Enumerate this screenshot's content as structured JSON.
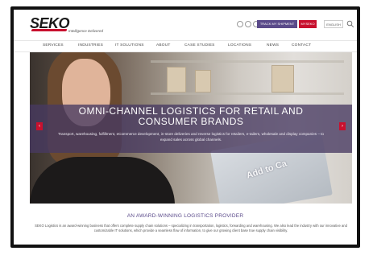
{
  "header": {
    "logo_text": "SEKO",
    "tagline": "Intelligence Delivered",
    "track_button": "TRACK MY SHIPMENT",
    "myseko_button": "MYSEKO",
    "language": "ENGLISH"
  },
  "nav": {
    "items": [
      "SERVICES",
      "INDUSTRIES",
      "IT SOLUTIONS",
      "ABOUT",
      "CASE STUDIES",
      "LOCATIONS",
      "NEWS",
      "CONTACT"
    ]
  },
  "hero": {
    "title": "OMNI-CHANNEL LOGISTICS FOR RETAIL AND CONSUMER BRANDS",
    "subtitle": "Transport, warehousing, fulfillment, eCommerce development, in-store deliveries and reverse logistics for retailers, e-tailers, wholesale and display companies – to expand sales across global channels.",
    "laptop_text": "Add to Ca",
    "prev_arrow": "‹",
    "next_arrow": "›"
  },
  "section": {
    "heading": "AN AWARD-WINNING LOGISTICS PROVIDER",
    "body": "SEKO Logistics is an award-winning business that offers complete supply chain solutions – specializing in transportation, logistics, forwarding and warehousing. We also lead the industry with our innovative and customizable IT solutions, which provide a seamless flow of information, to give our growing client base true supply chain visibility."
  },
  "colors": {
    "brand_red": "#c8102e",
    "brand_purple": "#5a4a8a",
    "hero_band": "#483a62"
  },
  "icons": {
    "social": [
      "facebook-icon",
      "twitter-icon",
      "linkedin-icon"
    ],
    "search": "search-icon"
  }
}
